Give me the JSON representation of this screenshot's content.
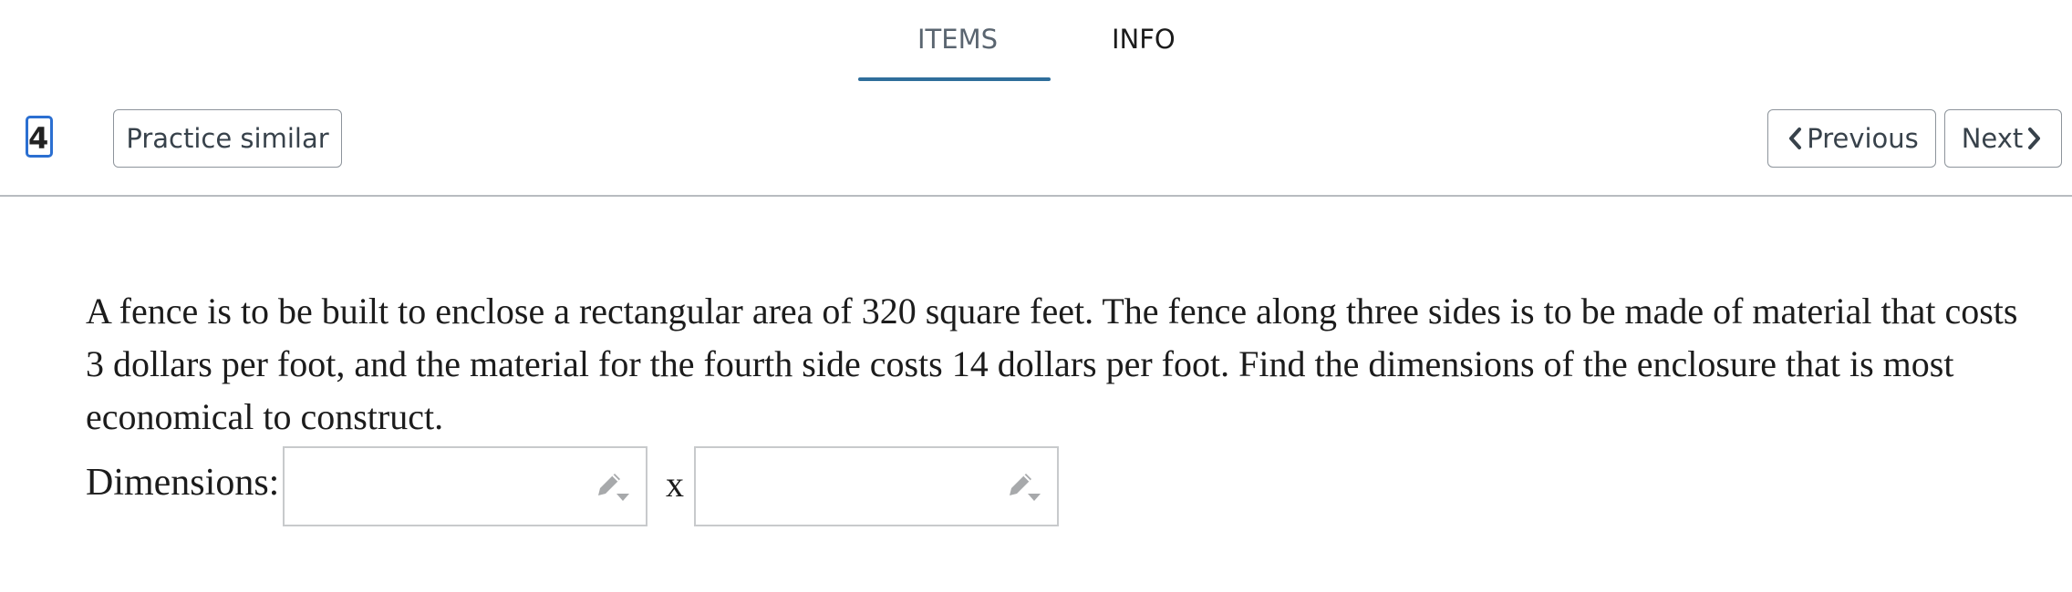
{
  "tabs": [
    {
      "label": "ITEMS",
      "active": true
    },
    {
      "label": "INFO",
      "active": false
    }
  ],
  "toolbar": {
    "question_number": "4.",
    "practice_label": "Practice similar",
    "previous_label": "Previous",
    "next_label": "Next"
  },
  "question": {
    "text": "A fence is to be built to enclose a rectangular area of 320 square feet. The fence along three sides is to be made of material that costs 3 dollars per foot, and the material for the fourth side costs 14 dollars per foot. Find the dimensions of the enclosure that is most economical to construct."
  },
  "answer": {
    "label": "Dimensions:",
    "separator": "x",
    "field1_value": "",
    "field2_value": ""
  },
  "icons": {
    "edit": "pencil-dropdown-icon",
    "previous": "chevron-left-icon",
    "next": "chevron-right-icon"
  },
  "colors": {
    "tab_accent": "#2f6e9b",
    "focus_outline": "#2b6fd1",
    "icon_gray": "#a7a9ab"
  }
}
